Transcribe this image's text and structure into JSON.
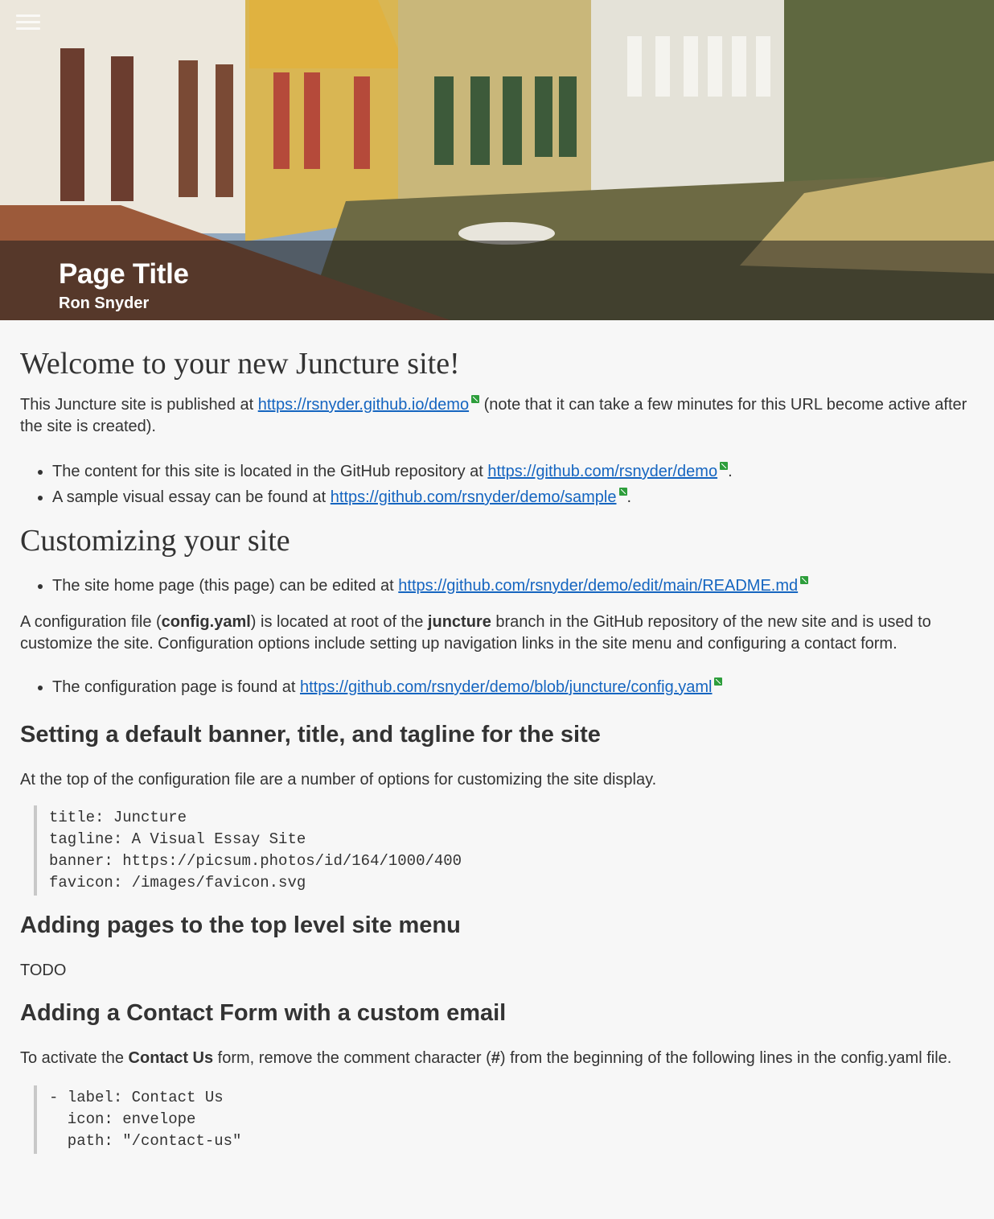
{
  "header": {
    "title": "Page Title",
    "author": "Ron Snyder"
  },
  "section_welcome": {
    "heading": "Welcome to your new Juncture site!",
    "intro_prefix": "This Juncture site is published at ",
    "intro_link": "https://rsnyder.github.io/demo",
    "intro_suffix": " (note that it can take a few minutes for this URL become active after the site is created).",
    "bullets": [
      {
        "prefix": "The content for this site is located in the GitHub repository at ",
        "link": "https://github.com/rsnyder/demo",
        "suffix": "."
      },
      {
        "prefix": "A sample visual essay can be found at ",
        "link": "https://github.com/rsnyder/demo/sample",
        "suffix": "."
      }
    ]
  },
  "section_customize": {
    "heading": "Customizing your site",
    "bullet_prefix": "The site home page (this page) can be edited at ",
    "bullet_link": "https://github.com/rsnyder/demo/edit/main/README.md",
    "para_part1": "A configuration file (",
    "para_bold1": "config.yaml",
    "para_part2": ") is located at root of the ",
    "para_bold2": "juncture",
    "para_part3": " branch in the GitHub repository of the new site and is used to customize the site. Configuration options include setting up navigation links in the site menu and configuring a contact form.",
    "config_bullet_prefix": "The configuration page is found at ",
    "config_bullet_link": "https://github.com/rsnyder/demo/blob/juncture/config.yaml"
  },
  "section_banner": {
    "heading": "Setting a default banner, title, and tagline for the site",
    "para": "At the top of the configuration file are a number of options for customizing the site display.",
    "code": "title: Juncture\ntagline: A Visual Essay Site\nbanner: https://picsum.photos/id/164/1000/400\nfavicon: /images/favicon.svg"
  },
  "section_menu": {
    "heading": "Adding pages to the top level site menu",
    "para": "TODO"
  },
  "section_contact": {
    "heading": "Adding a Contact Form with a custom email",
    "para_part1": "To activate the ",
    "para_bold": "Contact Us",
    "para_part2": " form, remove the comment character (",
    "para_hash": "#",
    "para_part3": ") from the beginning of the following lines in the config.yaml file.",
    "code": "- label: Contact Us\n  icon: envelope\n  path: \"/contact-us\""
  },
  "colors": {
    "link": "#1565c0",
    "external_icon": "#2e9e3c",
    "background": "#f7f7f7"
  },
  "icons": [
    "hamburger-menu-icon",
    "external-link-icon"
  ]
}
